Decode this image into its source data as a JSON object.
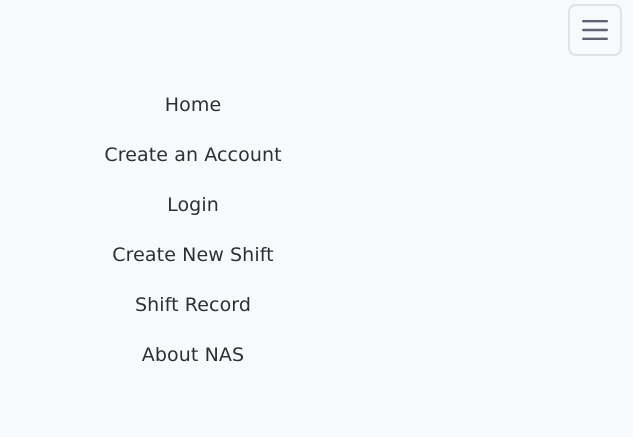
{
  "header": {
    "menu_toggle_icon": "hamburger-menu-icon"
  },
  "nav": {
    "items": [
      {
        "label": "Home"
      },
      {
        "label": "Create an Account"
      },
      {
        "label": "Login"
      },
      {
        "label": "Create New Shift"
      },
      {
        "label": "Shift Record"
      },
      {
        "label": "About NAS"
      }
    ]
  },
  "colors": {
    "background": "#f8f9fb",
    "text": "#2c2f33",
    "toggle_border": "#dfe2e7",
    "toggle_icon": "#5f6470"
  }
}
